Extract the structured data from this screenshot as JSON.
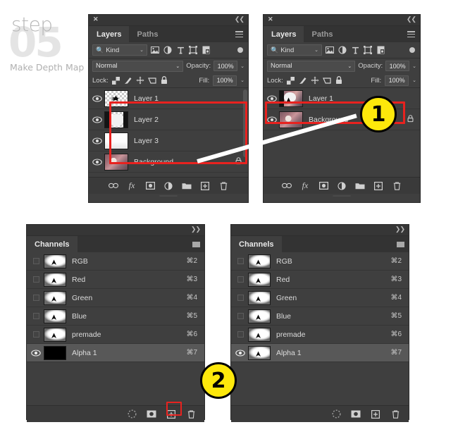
{
  "heading": {
    "step_word": "step",
    "step_number": "05",
    "subtitle": "Make Depth Map"
  },
  "colors": {
    "panel_bg": "#3f3f3f",
    "panel_titlebar": "#363636",
    "tab_active_bg": "#3f3f3f",
    "highlight_red": "#e8221f",
    "badge_yellow": "#fde80b",
    "text": "#dcdcdc",
    "connector_white": "#ffffff"
  },
  "layers_panel_left": {
    "titlebar": {
      "close": "✕",
      "collapse": "❮❮"
    },
    "tabs": [
      {
        "label": "Layers",
        "active": true
      },
      {
        "label": "Paths",
        "active": false
      }
    ],
    "menu_icon": "panel-menu-icon",
    "filter": {
      "search_icon": "search-icon",
      "kind_label": "Kind",
      "chevron": "⌄",
      "icons": [
        "pixel-layer-icon",
        "adjustment-layer-icon",
        "type-layer-icon",
        "shape-layer-icon",
        "smart-object-icon"
      ],
      "toggle": "filter-toggle"
    },
    "blend": {
      "mode": "Normal",
      "chevron": "⌄",
      "opacity_label": "Opacity:",
      "opacity_value": "100%"
    },
    "lock": {
      "label": "Lock:",
      "icons": [
        "lock-transparency-icon",
        "lock-image-icon",
        "lock-position-icon",
        "lock-artboard-icon",
        "lock-all-icon"
      ],
      "fill_label": "Fill:",
      "fill_value": "100%"
    },
    "layers": [
      {
        "name": "Layer 1",
        "visible": true,
        "locked": false,
        "selected": false,
        "thumb": "transparent-arrow"
      },
      {
        "name": "Layer 2",
        "visible": true,
        "locked": false,
        "selected": false,
        "thumb": "transparent-head"
      },
      {
        "name": "Layer 3",
        "visible": true,
        "locked": false,
        "selected": false,
        "thumb": "white-gradient"
      },
      {
        "name": "Background",
        "visible": true,
        "locked": true,
        "selected": false,
        "thumb": "photo"
      }
    ],
    "lock_glyph": "🔒",
    "tools": [
      "link-layers-icon",
      "layer-style-fx-icon",
      "layer-mask-icon",
      "adjustment-layer-icon",
      "new-group-icon",
      "new-layer-icon",
      "delete-layer-icon"
    ],
    "tool_labels": [
      "",
      "fx",
      "",
      "",
      "",
      "",
      ""
    ]
  },
  "layers_panel_right": {
    "titlebar": {
      "close": "✕",
      "collapse": "❮❮"
    },
    "tabs": [
      {
        "label": "Layers",
        "active": true
      },
      {
        "label": "Paths",
        "active": false
      }
    ],
    "filter": {
      "kind_label": "Kind",
      "chevron": "⌄"
    },
    "blend": {
      "mode": "Normal",
      "chevron": "⌄",
      "opacity_label": "Opacity:",
      "opacity_value": "100%"
    },
    "lock": {
      "label": "Lock:",
      "fill_label": "Fill:",
      "fill_value": "100%"
    },
    "layers": [
      {
        "name": "Layer 1",
        "visible": true,
        "locked": false,
        "selected": false,
        "thumb": "merged-photo"
      },
      {
        "name": "Background",
        "visible": true,
        "locked": true,
        "selected": false,
        "thumb": "photo"
      }
    ],
    "lock_glyph": "🔒"
  },
  "channels_panel_left": {
    "titlebar": {
      "collapse": "❯❯"
    },
    "tabs": [
      {
        "label": "Channels",
        "active": true
      }
    ],
    "menu_icon": "panel-menu-icon",
    "channels": [
      {
        "name": "RGB",
        "shortcut": "⌘2",
        "visible": false,
        "selected": false,
        "thumb": "channel"
      },
      {
        "name": "Red",
        "shortcut": "⌘3",
        "visible": false,
        "selected": false,
        "thumb": "channel"
      },
      {
        "name": "Green",
        "shortcut": "⌘4",
        "visible": false,
        "selected": false,
        "thumb": "channel"
      },
      {
        "name": "Blue",
        "shortcut": "⌘5",
        "visible": false,
        "selected": false,
        "thumb": "channel"
      },
      {
        "name": "premade",
        "shortcut": "⌘6",
        "visible": false,
        "selected": false,
        "thumb": "channel"
      },
      {
        "name": "Alpha 1",
        "shortcut": "⌘7",
        "visible": true,
        "selected": true,
        "thumb": "black"
      }
    ],
    "tools": [
      "load-selection-icon",
      "save-selection-icon",
      "new-channel-icon",
      "delete-channel-icon"
    ]
  },
  "channels_panel_right": {
    "titlebar": {
      "collapse": "❯❯"
    },
    "tabs": [
      {
        "label": "Channels",
        "active": true
      }
    ],
    "channels": [
      {
        "name": "RGB",
        "shortcut": "⌘2",
        "visible": false,
        "selected": false,
        "thumb": "channel"
      },
      {
        "name": "Red",
        "shortcut": "⌘3",
        "visible": false,
        "selected": false,
        "thumb": "channel"
      },
      {
        "name": "Green",
        "shortcut": "⌘4",
        "visible": false,
        "selected": false,
        "thumb": "channel"
      },
      {
        "name": "Blue",
        "shortcut": "⌘5",
        "visible": false,
        "selected": false,
        "thumb": "channel"
      },
      {
        "name": "premade",
        "shortcut": "⌘6",
        "visible": false,
        "selected": false,
        "thumb": "channel"
      },
      {
        "name": "Alpha 1",
        "shortcut": "⌘7",
        "visible": true,
        "selected": true,
        "thumb": "channel"
      }
    ],
    "tools": [
      "load-selection-icon",
      "save-selection-icon",
      "new-channel-icon",
      "delete-channel-icon"
    ]
  },
  "annotations": {
    "badge_one": "1",
    "badge_two": "2",
    "highlight_layers_group": "red-box-around-layer-1-2-3",
    "highlight_merged_layer": "red-box-around-layer-1",
    "highlight_new_channel": "red-box-around-new-channel-button",
    "connector": "white-diagonal-arrow-line"
  }
}
